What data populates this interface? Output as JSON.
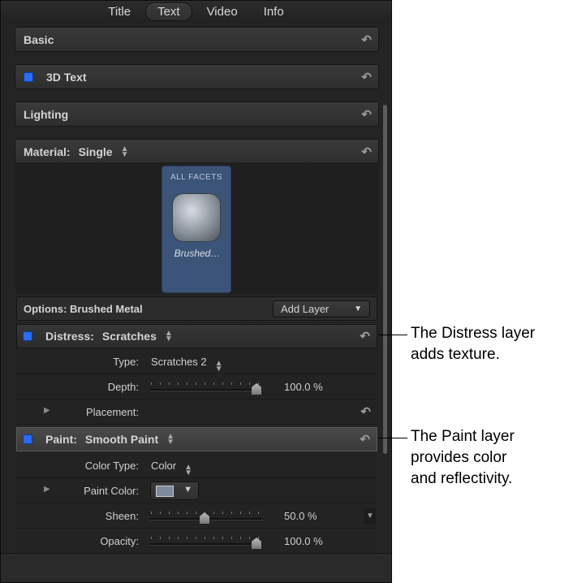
{
  "tabs": [
    {
      "label": "Title",
      "active": false
    },
    {
      "label": "Text",
      "active": true
    },
    {
      "label": "Video",
      "active": false
    },
    {
      "label": "Info",
      "active": false
    }
  ],
  "sections": {
    "basic": "Basic",
    "text3d": "3D Text",
    "lighting": "Lighting",
    "material_label": "Material:",
    "material_value": "Single"
  },
  "facet": {
    "title": "ALL FACETS",
    "name": "Brushed…"
  },
  "options": {
    "label": "Options: Brushed Metal",
    "add_layer": "Add Layer"
  },
  "distress": {
    "label": "Distress:",
    "value": "Scratches",
    "type_label": "Type:",
    "type_value": "Scratches 2",
    "depth_label": "Depth:",
    "depth_value": "100.0",
    "depth_fraction": 1.0,
    "placement_label": "Placement:"
  },
  "paint": {
    "label": "Paint:",
    "value": "Smooth Paint",
    "color_type_label": "Color Type:",
    "color_type_value": "Color",
    "paint_color_label": "Paint Color:",
    "paint_color": "#7f8a9e",
    "sheen_label": "Sheen:",
    "sheen_value": "50.0",
    "sheen_fraction": 0.5,
    "opacity_label": "Opacity:",
    "opacity_value": "100.0",
    "opacity_fraction": 1.0
  },
  "unit": "%",
  "callouts": {
    "distress": [
      "The Distress layer",
      "adds texture."
    ],
    "paint": [
      "The Paint layer",
      "provides color",
      "and reflectivity."
    ]
  },
  "colors": {
    "checkbox": "#2a6cf2",
    "facet_bg": "#3c5478"
  }
}
